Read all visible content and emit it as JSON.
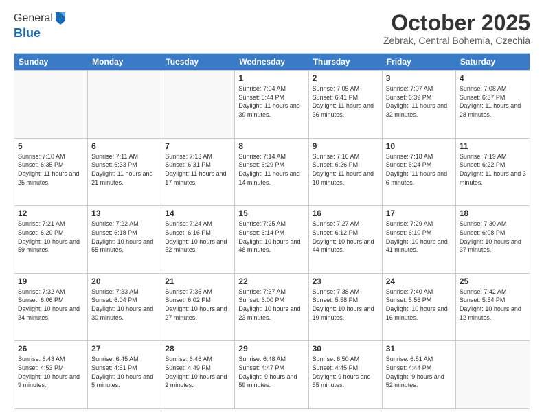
{
  "logo": {
    "general": "General",
    "blue": "Blue"
  },
  "header": {
    "month": "October 2025",
    "location": "Zebrak, Central Bohemia, Czechia"
  },
  "days_of_week": [
    "Sunday",
    "Monday",
    "Tuesday",
    "Wednesday",
    "Thursday",
    "Friday",
    "Saturday"
  ],
  "weeks": [
    [
      {
        "day": "",
        "info": ""
      },
      {
        "day": "",
        "info": ""
      },
      {
        "day": "",
        "info": ""
      },
      {
        "day": "1",
        "info": "Sunrise: 7:04 AM\nSunset: 6:44 PM\nDaylight: 11 hours\nand 39 minutes."
      },
      {
        "day": "2",
        "info": "Sunrise: 7:05 AM\nSunset: 6:41 PM\nDaylight: 11 hours\nand 36 minutes."
      },
      {
        "day": "3",
        "info": "Sunrise: 7:07 AM\nSunset: 6:39 PM\nDaylight: 11 hours\nand 32 minutes."
      },
      {
        "day": "4",
        "info": "Sunrise: 7:08 AM\nSunset: 6:37 PM\nDaylight: 11 hours\nand 28 minutes."
      }
    ],
    [
      {
        "day": "5",
        "info": "Sunrise: 7:10 AM\nSunset: 6:35 PM\nDaylight: 11 hours\nand 25 minutes."
      },
      {
        "day": "6",
        "info": "Sunrise: 7:11 AM\nSunset: 6:33 PM\nDaylight: 11 hours\nand 21 minutes."
      },
      {
        "day": "7",
        "info": "Sunrise: 7:13 AM\nSunset: 6:31 PM\nDaylight: 11 hours\nand 17 minutes."
      },
      {
        "day": "8",
        "info": "Sunrise: 7:14 AM\nSunset: 6:29 PM\nDaylight: 11 hours\nand 14 minutes."
      },
      {
        "day": "9",
        "info": "Sunrise: 7:16 AM\nSunset: 6:26 PM\nDaylight: 11 hours\nand 10 minutes."
      },
      {
        "day": "10",
        "info": "Sunrise: 7:18 AM\nSunset: 6:24 PM\nDaylight: 11 hours\nand 6 minutes."
      },
      {
        "day": "11",
        "info": "Sunrise: 7:19 AM\nSunset: 6:22 PM\nDaylight: 11 hours\nand 3 minutes."
      }
    ],
    [
      {
        "day": "12",
        "info": "Sunrise: 7:21 AM\nSunset: 6:20 PM\nDaylight: 10 hours\nand 59 minutes."
      },
      {
        "day": "13",
        "info": "Sunrise: 7:22 AM\nSunset: 6:18 PM\nDaylight: 10 hours\nand 55 minutes."
      },
      {
        "day": "14",
        "info": "Sunrise: 7:24 AM\nSunset: 6:16 PM\nDaylight: 10 hours\nand 52 minutes."
      },
      {
        "day": "15",
        "info": "Sunrise: 7:25 AM\nSunset: 6:14 PM\nDaylight: 10 hours\nand 48 minutes."
      },
      {
        "day": "16",
        "info": "Sunrise: 7:27 AM\nSunset: 6:12 PM\nDaylight: 10 hours\nand 44 minutes."
      },
      {
        "day": "17",
        "info": "Sunrise: 7:29 AM\nSunset: 6:10 PM\nDaylight: 10 hours\nand 41 minutes."
      },
      {
        "day": "18",
        "info": "Sunrise: 7:30 AM\nSunset: 6:08 PM\nDaylight: 10 hours\nand 37 minutes."
      }
    ],
    [
      {
        "day": "19",
        "info": "Sunrise: 7:32 AM\nSunset: 6:06 PM\nDaylight: 10 hours\nand 34 minutes."
      },
      {
        "day": "20",
        "info": "Sunrise: 7:33 AM\nSunset: 6:04 PM\nDaylight: 10 hours\nand 30 minutes."
      },
      {
        "day": "21",
        "info": "Sunrise: 7:35 AM\nSunset: 6:02 PM\nDaylight: 10 hours\nand 27 minutes."
      },
      {
        "day": "22",
        "info": "Sunrise: 7:37 AM\nSunset: 6:00 PM\nDaylight: 10 hours\nand 23 minutes."
      },
      {
        "day": "23",
        "info": "Sunrise: 7:38 AM\nSunset: 5:58 PM\nDaylight: 10 hours\nand 19 minutes."
      },
      {
        "day": "24",
        "info": "Sunrise: 7:40 AM\nSunset: 5:56 PM\nDaylight: 10 hours\nand 16 minutes."
      },
      {
        "day": "25",
        "info": "Sunrise: 7:42 AM\nSunset: 5:54 PM\nDaylight: 10 hours\nand 12 minutes."
      }
    ],
    [
      {
        "day": "26",
        "info": "Sunrise: 6:43 AM\nSunset: 4:53 PM\nDaylight: 10 hours\nand 9 minutes."
      },
      {
        "day": "27",
        "info": "Sunrise: 6:45 AM\nSunset: 4:51 PM\nDaylight: 10 hours\nand 5 minutes."
      },
      {
        "day": "28",
        "info": "Sunrise: 6:46 AM\nSunset: 4:49 PM\nDaylight: 10 hours\nand 2 minutes."
      },
      {
        "day": "29",
        "info": "Sunrise: 6:48 AM\nSunset: 4:47 PM\nDaylight: 9 hours\nand 59 minutes."
      },
      {
        "day": "30",
        "info": "Sunrise: 6:50 AM\nSunset: 4:45 PM\nDaylight: 9 hours\nand 55 minutes."
      },
      {
        "day": "31",
        "info": "Sunrise: 6:51 AM\nSunset: 4:44 PM\nDaylight: 9 hours\nand 52 minutes."
      },
      {
        "day": "",
        "info": ""
      }
    ]
  ]
}
